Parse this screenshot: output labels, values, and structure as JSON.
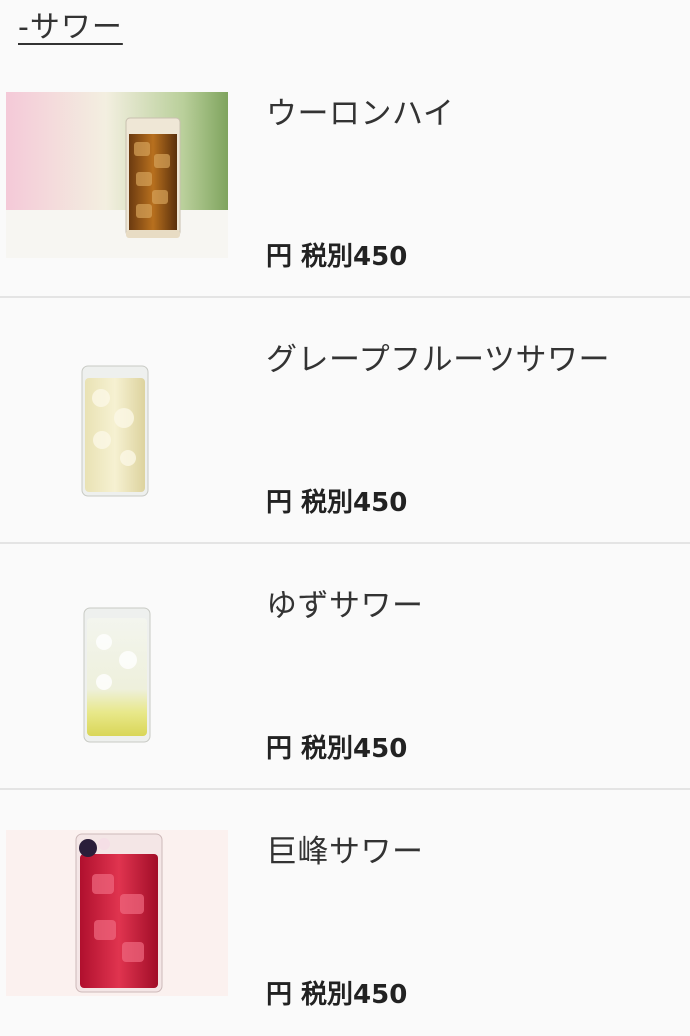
{
  "section": {
    "title": "-サワー"
  },
  "items": [
    {
      "name": "ウーロンハイ",
      "price": "円 税別450",
      "image": "oolong-highball-glass"
    },
    {
      "name": "グレープフルーツサワー",
      "price": "円 税別450",
      "image": "grapefruit-sour-glass"
    },
    {
      "name": "ゆずサワー",
      "price": "円 税別450",
      "image": "yuzu-sour-glass"
    },
    {
      "name": "巨峰サワー",
      "price": "円 税別450",
      "image": "kyoho-grape-sour-glass"
    }
  ]
}
